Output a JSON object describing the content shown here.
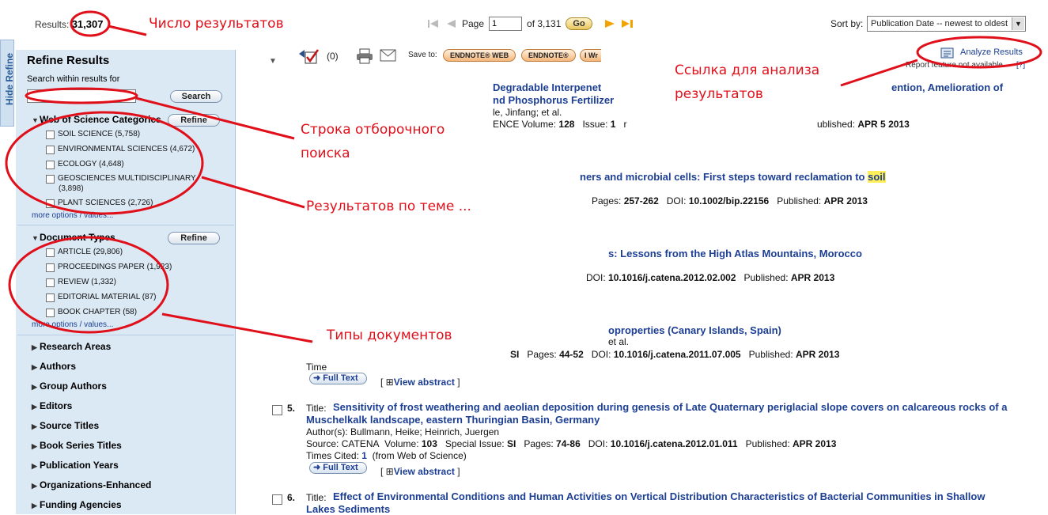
{
  "top": {
    "results_label": "Results:",
    "results_count": "31,307",
    "page_label": "Page",
    "page_value": "1",
    "page_of": "of 3,131",
    "go_label": "Go",
    "sort_label": "Sort by:",
    "sort_value": "Publication Date -- newest to oldest"
  },
  "toolbar": {
    "marked_count": "(0)",
    "save_to_label": "Save to:",
    "endnote_web": "ENDNOTE® WEB",
    "endnote": "ENDNOTE®",
    "i_wr": "I Wr",
    "analyze_results": "Analyze Results",
    "report_text": "Report feature not available.",
    "help": "[?]"
  },
  "sidebar": {
    "hide_refine": "Hide Refine",
    "title": "Refine Results",
    "search_within_label": "Search within results for",
    "search_button": "Search",
    "wos_categories": {
      "title": "Web of Science Categories",
      "refine": "Refine",
      "items": [
        {
          "label": "SOIL SCIENCE (5,758)"
        },
        {
          "label": "ENVIRONMENTAL SCIENCES (4,672)"
        },
        {
          "label": "ECOLOGY (4,648)"
        },
        {
          "label": "GEOSCIENCES MULTIDISCIPLINARY"
        },
        {
          "label": "(3,898)"
        },
        {
          "label": "PLANT SCIENCES (2,726)"
        }
      ],
      "more": "more options / values..."
    },
    "doc_types": {
      "title": "Document Types",
      "refine": "Refine",
      "items": [
        {
          "label": "ARTICLE (29,806)"
        },
        {
          "label": "PROCEEDINGS PAPER (1,923)"
        },
        {
          "label": "REVIEW (1,332)"
        },
        {
          "label": "EDITORIAL MATERIAL (87)"
        },
        {
          "label": "BOOK CHAPTER (58)"
        }
      ],
      "more": "more options / values..."
    },
    "collapsed": [
      "Research Areas",
      "Authors",
      "Group Authors",
      "Editors",
      "Source Titles",
      "Book Series Titles",
      "Publication Years",
      "Organizations-Enhanced",
      "Funding Agencies"
    ]
  },
  "results": {
    "r1": {
      "title_a": "Degradable Interpenet",
      "title_b": "nd Phosphorus Fertilizer",
      "title_c": "ention, Amelioration of",
      "authors": "le, Jinfang; et al.",
      "source_a": "ENCE  Volume:",
      "volume": "128",
      "issue_label": "Issue:",
      "issue": "1",
      "published_label": "ublished:",
      "published": "APR 5 2013"
    },
    "r2": {
      "title_a": "ners and microbial cells: First steps toward reclamation to",
      "title_hl": "soil",
      "pages_label": "Pages:",
      "pages": "257-262",
      "doi_label": "DOI:",
      "doi": "10.1002/bip.22156",
      "published_label": "Published:",
      "published": "APR 2013"
    },
    "r3": {
      "title": "s: Lessons from the High Atlas Mountains, Morocco",
      "doi_label": "DOI:",
      "doi": "10.1016/j.catena.2012.02.002",
      "published_label": "Published:",
      "published": "APR 2013"
    },
    "r4": {
      "title": "oproperties (Canary Islands, Spain)",
      "authors_tail": "et al.",
      "si": "SI",
      "pages_label": "Pages:",
      "pages": "44-52",
      "doi_label": "DOI:",
      "doi": "10.1016/j.catena.2011.07.005",
      "published_label": "Published:",
      "published": "APR 2013",
      "times_cited_a": "Time",
      "full_text": "Full Text",
      "view_abstract": "View abstract"
    },
    "r5": {
      "num": "5.",
      "title_label": "Title:",
      "title_1": "Sensitivity of frost weathering and aeolian deposition during genesis of Late Quaternary periglacial slope covers on calcareous rocks of a",
      "title_2": "Muschelkalk landscape, eastern Thuringian Basin, Germany",
      "authors": "Author(s): Bullmann, Heike; Heinrich, Juergen",
      "source_label": "Source:",
      "source": "CATENA",
      "volume_label": "Volume:",
      "volume": "103",
      "special_label": "Special Issue:",
      "special": "SI",
      "pages_label": "Pages:",
      "pages": "74-86",
      "doi_label": "DOI:",
      "doi": "10.1016/j.catena.2012.01.011",
      "published_label": "Published:",
      "published": "APR 2013",
      "times_cited_label": "Times Cited:",
      "times_cited": "1",
      "times_cited_from": "(from Web of Science)",
      "full_text": "Full Text",
      "view_abstract": "View abstract"
    },
    "r6": {
      "num": "6.",
      "title_label": "Title:",
      "title_1": "Effect of Environmental Conditions and Human Activities on Vertical Distribution Characteristics of Bacterial Communities in Shallow",
      "title_2": "Lakes Sediments"
    }
  },
  "annotations": {
    "count": "Число результатов",
    "search_line_1": "Строка отборочного",
    "search_line_2": "поиска",
    "topic": "Результатов по теме ...",
    "analysis_1": "Ссылка для анализа",
    "analysis_2": "результатов",
    "doc_types": "Типы документов"
  },
  "colors": {
    "annotation_red": "#e0101b",
    "sidebar_bg": "#dbe9f5",
    "link_blue": "#1c3f94",
    "highlight": "#ffef5a"
  }
}
